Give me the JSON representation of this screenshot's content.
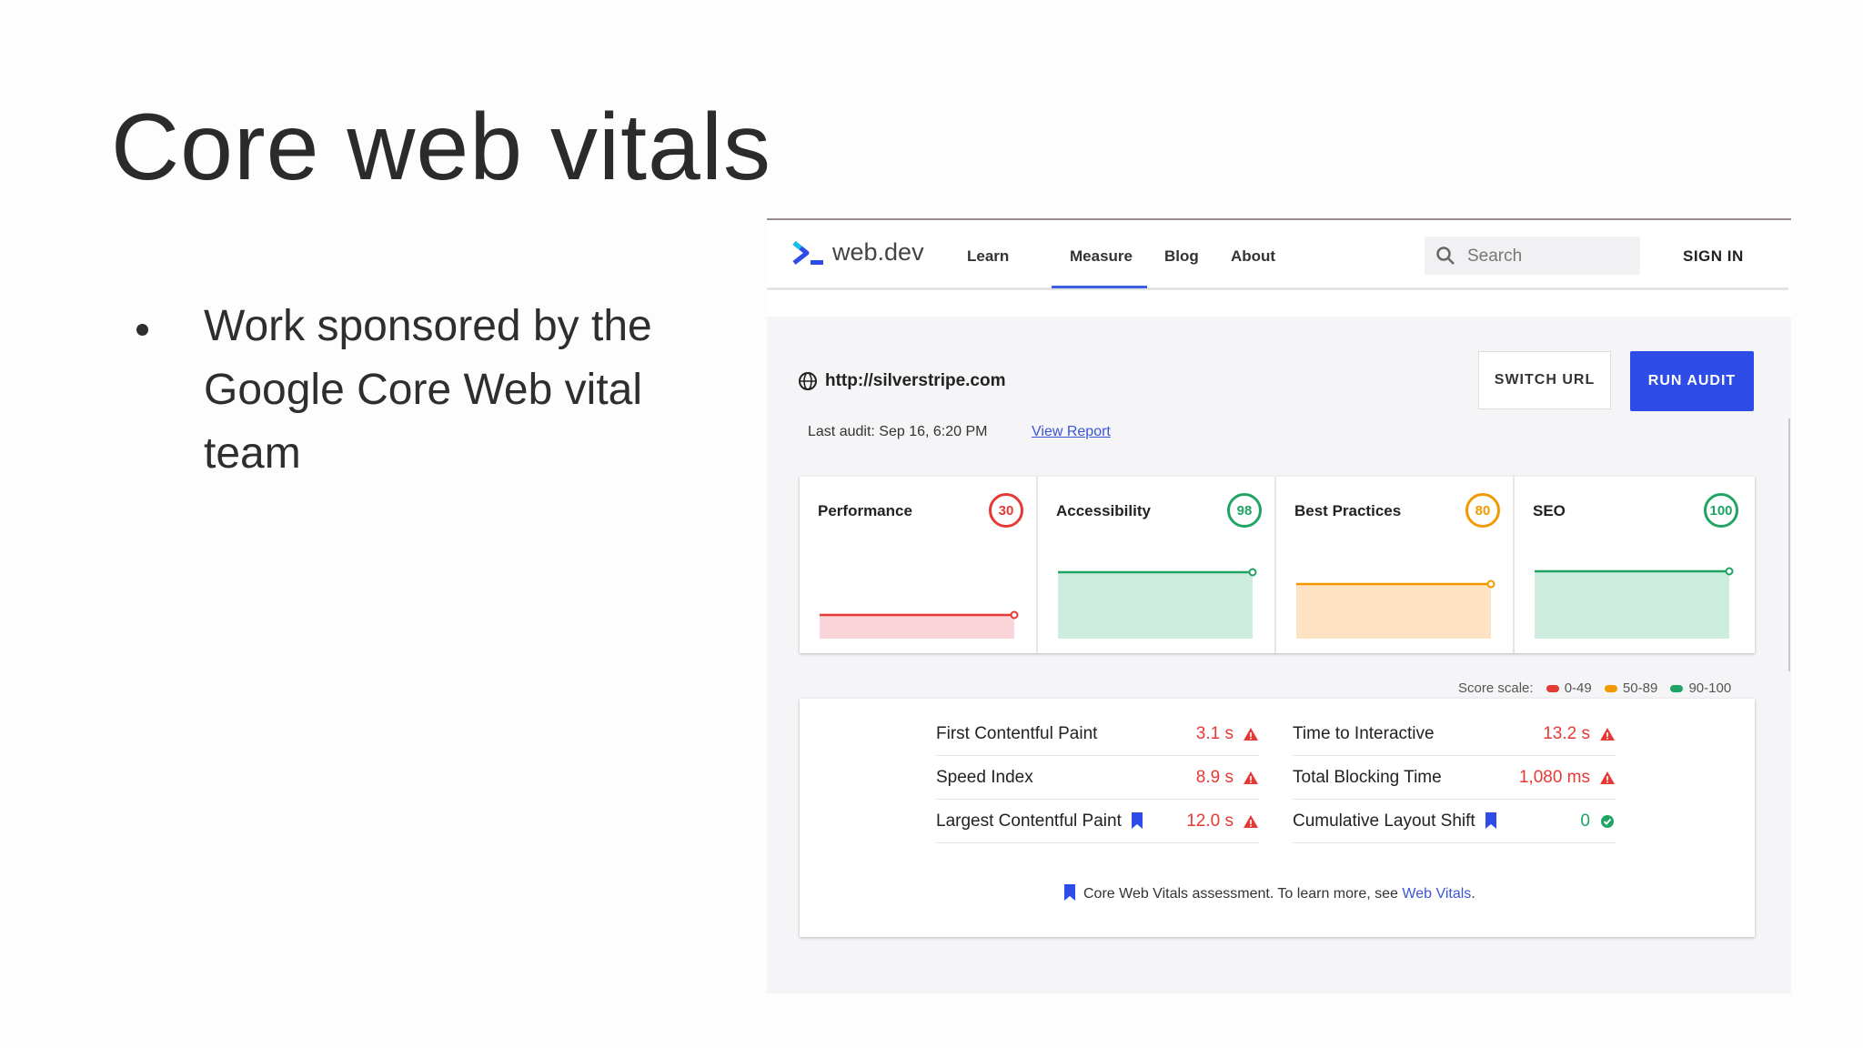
{
  "slide": {
    "title": "Core web vitals",
    "bullet": "Work sponsored by the Google Core Web vital team"
  },
  "nav": {
    "logo_text": "web.dev",
    "links": [
      "Learn",
      "Measure",
      "Blog",
      "About"
    ],
    "active_link": "Measure",
    "search_placeholder": "Search",
    "sign_in": "SIGN IN"
  },
  "audit": {
    "url": "http://silverstripe.com",
    "last_audit": "Last audit: Sep 16, 6:20 PM",
    "view_report": "View Report",
    "switch_url": "SWITCH URL",
    "run_audit": "RUN AUDIT"
  },
  "scores": [
    {
      "label": "Performance",
      "score": "30",
      "color": "#e53935",
      "fill": "#f9d5d9"
    },
    {
      "label": "Accessibility",
      "score": "98",
      "color": "#1fa463",
      "fill": "#cdeede"
    },
    {
      "label": "Best Practices",
      "score": "80",
      "color": "#f29900",
      "fill": "#fde2c4"
    },
    {
      "label": "SEO",
      "score": "100",
      "color": "#1fa463",
      "fill": "#cdeede"
    }
  ],
  "scale": {
    "label": "Score scale:",
    "ranges": [
      {
        "label": "0-49",
        "color": "#e53935"
      },
      {
        "label": "50-89",
        "color": "#f29900"
      },
      {
        "label": "90-100",
        "color": "#1fa463"
      }
    ]
  },
  "metrics": {
    "left": [
      {
        "name": "First Contentful Paint",
        "value": "3.1 s",
        "status": "fail",
        "core": false
      },
      {
        "name": "Speed Index",
        "value": "8.9 s",
        "status": "fail",
        "core": false
      },
      {
        "name": "Largest Contentful Paint",
        "value": "12.0 s",
        "status": "fail",
        "core": true
      }
    ],
    "right": [
      {
        "name": "Time to Interactive",
        "value": "13.2 s",
        "status": "fail",
        "core": false
      },
      {
        "name": "Total Blocking Time",
        "value": "1,080 ms",
        "status": "fail",
        "core": false
      },
      {
        "name": "Cumulative Layout Shift",
        "value": "0",
        "status": "pass",
        "core": true
      }
    ],
    "footnote_text": "Core Web Vitals assessment. To learn more, see",
    "footnote_link": "Web Vitals"
  }
}
